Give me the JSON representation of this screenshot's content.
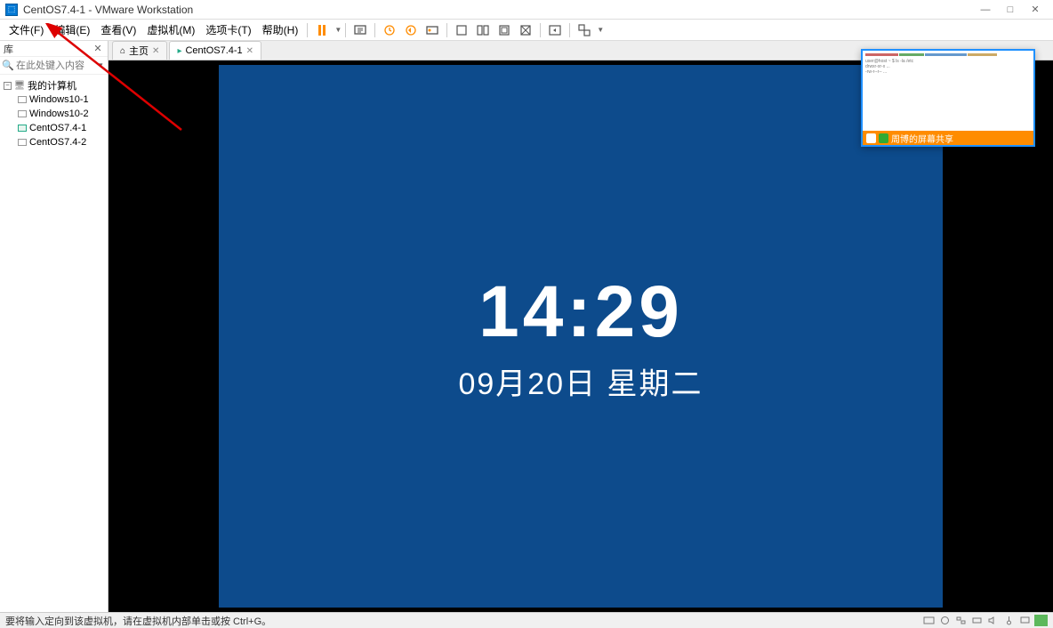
{
  "title": "CentOS7.4-1 - VMware Workstation",
  "window_controls": {
    "min": "—",
    "max": "□",
    "close": "✕"
  },
  "menu": {
    "file": "文件(F)",
    "edit": "编辑(E)",
    "view": "查看(V)",
    "vm": "虚拟机(M)",
    "tabs": "选项卡(T)",
    "help": "帮助(H)"
  },
  "sidebar": {
    "header": "库",
    "close": "✕",
    "search_placeholder": "在此处键入内容",
    "root": "我的计算机",
    "items": [
      {
        "label": "Windows10-1",
        "running": false
      },
      {
        "label": "Windows10-2",
        "running": false
      },
      {
        "label": "CentOS7.4-1",
        "running": true
      },
      {
        "label": "CentOS7.4-2",
        "running": false
      }
    ]
  },
  "tabs": {
    "home": "主页",
    "active": "CentOS7.4-1"
  },
  "vm": {
    "time": "14:29",
    "date": "09月20日 星期二"
  },
  "pip": {
    "caption": "周博的屏幕共享"
  },
  "statusbar": {
    "text": "要将输入定向到该虚拟机，请在虚拟机内部单击或按 Ctrl+G。"
  }
}
